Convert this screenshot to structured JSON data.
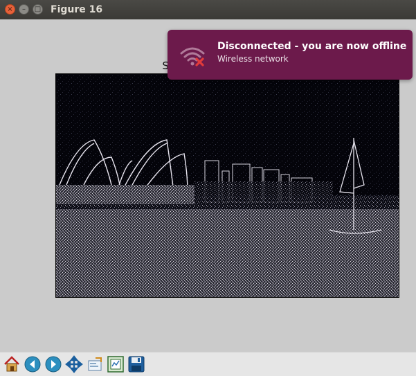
{
  "window": {
    "title": "Figure 16",
    "close_glyph": "×",
    "minimize_glyph": "–",
    "maximize_glyph": "□"
  },
  "plot": {
    "title": "Scharr Kernel combinado",
    "image_description_icon": "edge-detected-sydney-opera-house"
  },
  "notification": {
    "title": "Disconnected - you are now offline",
    "body": "Wireless network",
    "icon": "wifi-disconnected-icon",
    "background": "#6c1a4b"
  },
  "toolbar": {
    "buttons": [
      {
        "name": "home",
        "icon": "home-icon"
      },
      {
        "name": "back",
        "icon": "back-arrow-icon"
      },
      {
        "name": "forward",
        "icon": "forward-arrow-icon"
      },
      {
        "name": "pan",
        "icon": "pan-move-icon"
      },
      {
        "name": "zoom",
        "icon": "zoom-rect-icon"
      },
      {
        "name": "subplots",
        "icon": "configure-subplots-icon"
      },
      {
        "name": "save",
        "icon": "save-icon"
      }
    ]
  }
}
